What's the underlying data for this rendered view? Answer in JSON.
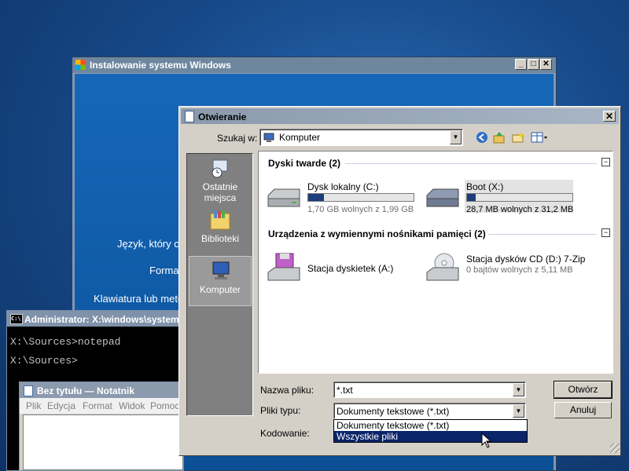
{
  "installer": {
    "title": "Instalowanie systemu Windows",
    "lines": [
      "Język, który ch",
      "Format",
      "Klawiatura lub meto"
    ]
  },
  "cmd": {
    "title": "Administrator: X:\\windows\\system",
    "lines": [
      "X:\\Sources>notepad",
      "X:\\Sources>"
    ]
  },
  "notepad": {
    "title": "Bez tytułu — Notatnik",
    "menu": [
      "Plik",
      "Edycja",
      "Format",
      "Widok",
      "Pomoc"
    ]
  },
  "dialog": {
    "title": "Otwieranie",
    "look_in_label": "Szukaj w:",
    "look_in_value": "Komputer",
    "places": [
      {
        "label": "Ostatnie miejsca",
        "icon": "recent-places-icon"
      },
      {
        "label": "Biblioteki",
        "icon": "libraries-icon"
      },
      {
        "label": "Komputer",
        "icon": "computer-icon",
        "selected": true
      }
    ],
    "groups": [
      {
        "title": "Dyski twarde (2)",
        "items": [
          {
            "name": "Dysk lokalny (C:)",
            "free": "1,70 GB wolnych z 1,99 GB",
            "used_fraction": 0.15
          },
          {
            "name": "Boot (X:)",
            "free": "28,7 MB wolnych z 31,2 MB",
            "used_fraction": 0.08
          }
        ]
      },
      {
        "title": "Urządzenia z wymiennymi nośnikami pamięci (2)",
        "items": [
          {
            "name": "Stacja dyskietek (A:)",
            "free": ""
          },
          {
            "name": "Stacja dysków CD (D:) 7-Zip",
            "free": "0 bajtów wolnych z 5,11 MB"
          }
        ]
      }
    ],
    "filename_label": "Nazwa pliku:",
    "filename_value": "*.txt",
    "filetype_label": "Pliki typu:",
    "filetype_value": "Dokumenty tekstowe (*.txt)",
    "encoding_label": "Kodowanie:",
    "filetype_options": [
      "Dokumenty tekstowe (*.txt)",
      "Wszystkie pliki"
    ],
    "filetype_selected_index": 1,
    "open_button": "Otwórz",
    "cancel_button": "Anuluj",
    "close_glyph": "✕",
    "collapse_glyph": "−"
  },
  "colors": {
    "selection": "#0a246a",
    "drive_bar_fill": "#1c3e7a",
    "desktop": "#174a8a"
  }
}
